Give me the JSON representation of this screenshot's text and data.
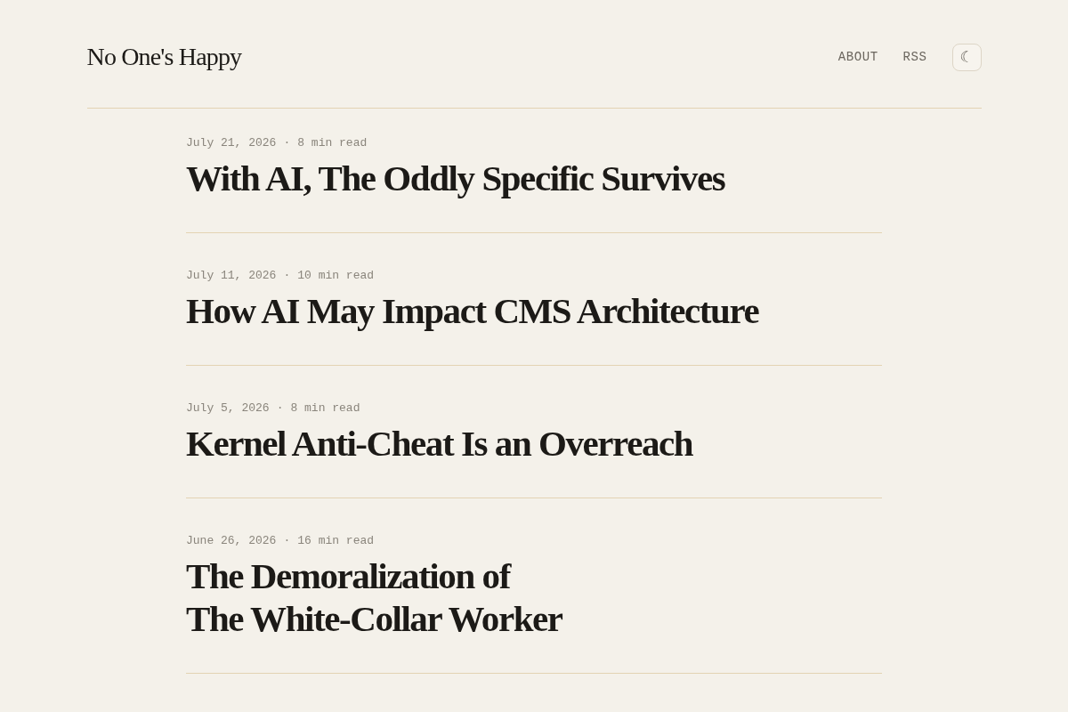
{
  "site": {
    "title": "No One's Happy"
  },
  "nav": [
    {
      "label": "ABOUT"
    },
    {
      "label": "RSS"
    }
  ],
  "theme_toggle": {
    "label": "☾"
  },
  "posts": [
    {
      "date": "July 21, 2026",
      "separator": "·",
      "read_time": "8 min read",
      "title": "With AI, The Oddly Specific Survives"
    },
    {
      "date": "July 11, 2026",
      "separator": "·",
      "read_time": "10 min read",
      "title": "How AI May Impact CMS Architecture"
    },
    {
      "date": "July 5, 2026",
      "separator": "·",
      "read_time": "8 min read",
      "title": "Kernel Anti-Cheat Is an Overreach"
    },
    {
      "date": "June 26, 2026",
      "separator": "·",
      "read_time": "16 min read",
      "title": "The Demoralization of\nThe White-Collar Worker"
    }
  ]
}
